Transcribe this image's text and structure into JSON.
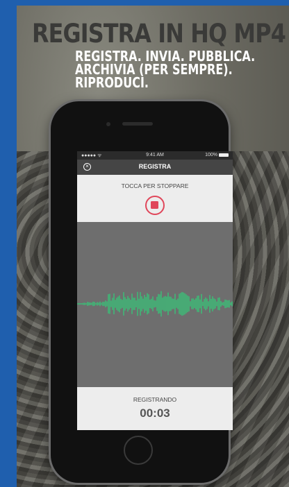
{
  "promo": {
    "headline": "REGISTRA IN HQ MP4",
    "subheadline_lines": [
      "REGISTRA. INVIA. PUBBLICA.",
      "ARCHIVIA (PER SEMPRE).",
      "RIPRODUCI."
    ]
  },
  "statusbar": {
    "signal": "●●●●● ᯤ",
    "time": "9:41 AM",
    "battery": "100%"
  },
  "navbar": {
    "title": "REGISTRA",
    "close_icon": "close-icon"
  },
  "recorder": {
    "instruction": "TOCCA PER STOPPARE",
    "stop_icon": "stop-icon",
    "state": "REGISTRANDO",
    "elapsed": "00:03"
  },
  "colors": {
    "accent_red": "#e0465a",
    "waveform_green": "#2fd17a",
    "border_blue": "#1f5fae"
  }
}
